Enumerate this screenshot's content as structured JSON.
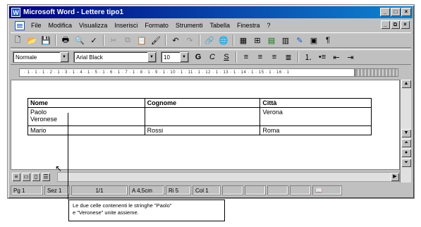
{
  "window": {
    "app_icon": "W",
    "title": "Microsoft Word - Lettere tipo1",
    "controls": [
      "_",
      "□",
      "×"
    ]
  },
  "menubar": {
    "items": [
      "File",
      "Modifica",
      "Visualizza",
      "Inserisci",
      "Formato",
      "Strumenti",
      "Tabella",
      "Finestra",
      "?"
    ],
    "doc_controls": [
      "_",
      "ם",
      "×"
    ]
  },
  "toolbar_standard": {
    "icons": [
      "new-icon",
      "open-icon",
      "save-icon",
      "print-icon",
      "print-preview-icon",
      "spelling-icon",
      "cut-icon",
      "copy-icon",
      "paste-icon",
      "format-painter-icon",
      "undo-icon",
      "redo-icon",
      "hyperlink-icon",
      "web-toolbar-icon",
      "tables-borders-icon",
      "insert-table-icon",
      "insert-excel-icon",
      "columns-icon",
      "drawing-icon",
      "document-map-icon",
      "show-hide-icon"
    ]
  },
  "toolbar_format": {
    "style": "Normale",
    "font": "Arial Black",
    "size": "10",
    "bold": "G",
    "italic": "C",
    "underline": "S"
  },
  "ruler": {
    "text": "· 1 · 1 · 1 · 2 · 1 · 3 · 1 · 4 · 1 · 5 · 1 · 6 · 1 · 7 · 1 · 8 · 1 · 9 · 1 · 10 · 1 · 11 · 1 · 12 · 1 · 13 · 1 · 14 · 1 · 15 · 1 · 16 · 1"
  },
  "table": {
    "headers": [
      "Nome",
      "Cognome",
      "Città"
    ],
    "rows": [
      [
        "Paolo",
        "",
        "Verona"
      ],
      [
        "Veronese",
        "",
        ""
      ],
      [
        "Mario",
        "Rossi",
        "Roma"
      ]
    ]
  },
  "statusbar": {
    "page": "Pg 1",
    "section": "Sez 1",
    "page_of": "1/1",
    "at": "A 4,5cm",
    "line": "Ri 5",
    "col": "Col 1"
  },
  "callout": {
    "line1": "Le due celle contenenti le stringhe \"Paolo\"",
    "line2": "e \"Veronese\" unite assieme."
  }
}
